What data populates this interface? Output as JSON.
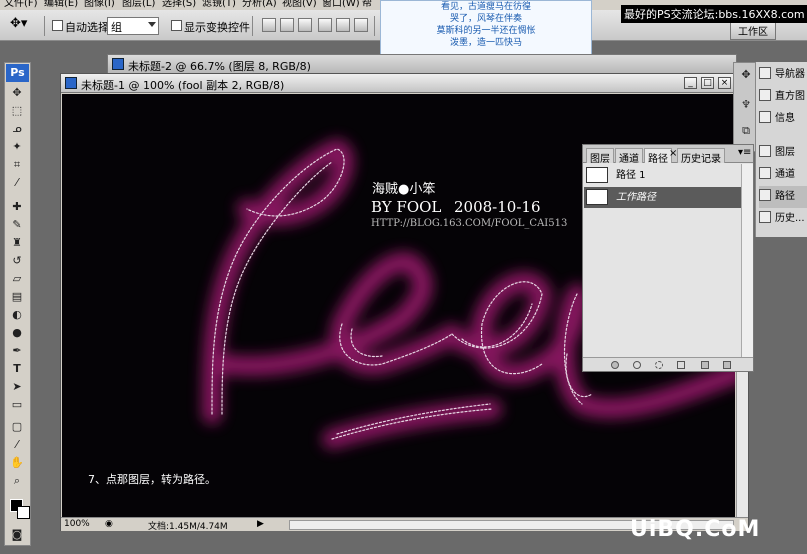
{
  "menubar": {
    "items": [
      "文件(F)",
      "编辑(E)",
      "图像(I)",
      "图层(L)",
      "选择(S)",
      "滤镜(T)",
      "分析(A)",
      "视图(V)",
      "窗口(W)",
      "帮"
    ]
  },
  "options": {
    "auto_select_label": "自动选择:",
    "auto_select_value": "组",
    "show_transform_label": "显示变换控件",
    "workspace_label": "工作区"
  },
  "popup": {
    "lines": [
      "看见，古道瘦马在彷徨",
      "哭了，风琴在伴奏",
      "莫斯科的另一半还在惆怅",
      "泼墨，造一匹快马"
    ]
  },
  "watermark_top": "最好的PS交流论坛:bbs.16XX8.com",
  "back_window": {
    "title": "未标题-2 @ 66.7% (图层 8, RGB/8)"
  },
  "document": {
    "title": "未标题-1 @ 100% (fool 副本 2, RGB/8)",
    "canvas_text": {
      "name": "海贼●小笨",
      "by_line": "BY FOOL",
      "date": "2008-10-16",
      "url": "HTTP://BLOG.163.COM/FOOL_CAI513",
      "step": "7、点那图层，转为路径。"
    },
    "zoom": "100%",
    "doc_info": "文档:1.45M/4.74M"
  },
  "paths_panel": {
    "tabs": [
      "图层",
      "通道",
      "路径",
      "历史记录"
    ],
    "rows": [
      "路径 1",
      "工作路径"
    ]
  },
  "dock": {
    "items": [
      "导航器",
      "直方图",
      "信息",
      "图层",
      "通道",
      "路径",
      "历史..."
    ]
  },
  "footer_logo": "UiBQ.CoM",
  "colors": {
    "glow": "#c0208a",
    "selection": "#5b5b5b",
    "ps_blue": "#2a66c8"
  }
}
